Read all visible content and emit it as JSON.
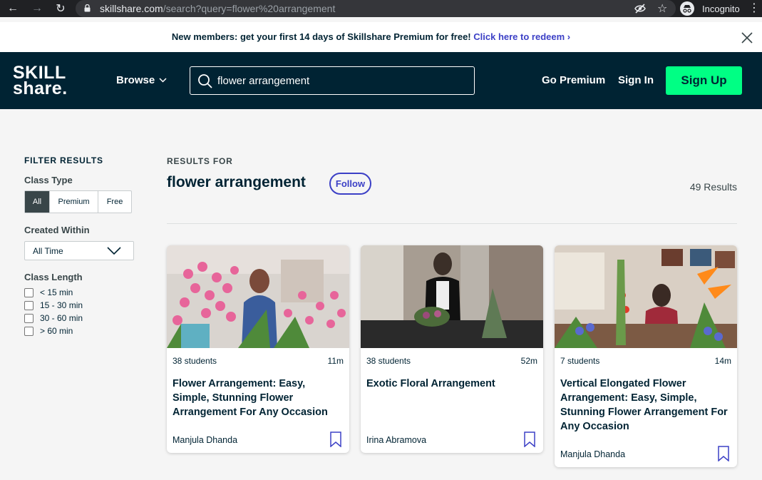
{
  "browser": {
    "url_host": "skillshare.com",
    "url_path": "/search?query=flower%20arrangement",
    "profile_label": "Incognito"
  },
  "promo": {
    "text": "New members: get your first 14 days of Skillshare Premium for free!",
    "link_text": "Click here to redeem"
  },
  "header": {
    "logo_line1": "SKILL",
    "logo_line2": "share.",
    "browse_label": "Browse",
    "search_value": "flower arrangement",
    "go_premium": "Go Premium",
    "sign_in": "Sign In",
    "sign_up": "Sign Up"
  },
  "filters": {
    "title": "FILTER RESULTS",
    "class_type_label": "Class Type",
    "class_type_options": [
      "All",
      "Premium",
      "Free"
    ],
    "created_within_label": "Created Within",
    "created_within_value": "All Time",
    "class_length_label": "Class Length",
    "class_length_options": [
      "< 15 min",
      "15 - 30 min",
      "30 - 60 min",
      "> 60 min"
    ]
  },
  "results": {
    "heading": "RESULTS FOR",
    "query": "flower arrangement",
    "follow_label": "Follow",
    "count": "49 Results"
  },
  "cards": [
    {
      "students": "38 students",
      "duration": "11m",
      "title": "Flower Arrangement: Easy, Simple, Stunning Flower Arrangement For Any Occasion",
      "author": "Manjula Dhanda"
    },
    {
      "students": "38 students",
      "duration": "52m",
      "title": "Exotic Floral Arrangement",
      "author": "Irina Abramova"
    },
    {
      "students": "7 students",
      "duration": "14m",
      "title": "Vertical Elongated Flower Arrangement: Easy, Simple, Stunning Flower Arrangement For Any Occasion",
      "author": "Manjula Dhanda"
    }
  ],
  "colors": {
    "header_bg": "#002333",
    "accent_green": "#00ff84",
    "link_purple": "#3c40c6",
    "page_bg": "#f5f5f5"
  }
}
